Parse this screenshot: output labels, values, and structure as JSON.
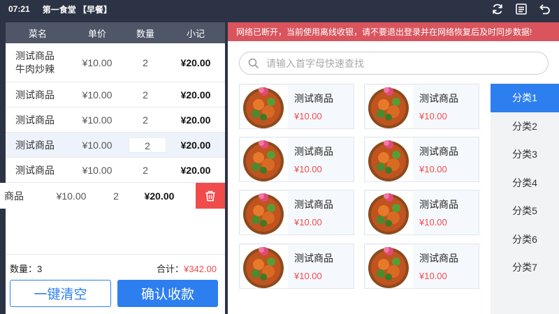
{
  "status_bar": {
    "time": "07:21",
    "store": "第一食堂 【早餐】"
  },
  "top_icons": [
    "sync-icon",
    "list-icon",
    "back-icon"
  ],
  "cart": {
    "headers": [
      "菜名",
      "单价",
      "数量",
      "小记"
    ],
    "rows": [
      {
        "name": "测试商品\n牛肉炒辣",
        "price": "¥10.00",
        "qty": "2",
        "subtotal": "¥20.00"
      },
      {
        "name": "测试商品",
        "price": "¥10.00",
        "qty": "2",
        "subtotal": "¥20.00"
      },
      {
        "name": "测试商品",
        "price": "¥10.00",
        "qty": "2",
        "subtotal": "¥20.00"
      },
      {
        "name": "测试商品",
        "price": "¥10.00",
        "qty": "2",
        "subtotal": "¥20.00"
      },
      {
        "name": "测试商品",
        "price": "¥10.00",
        "qty": "2",
        "subtotal": "¥20.00"
      }
    ],
    "swiped_row": {
      "name": "商品",
      "price": "¥10.00",
      "qty": "2",
      "subtotal": "¥20.00"
    },
    "qty_label": "数量：3",
    "total_label": "合计：",
    "total_amount": "¥342.00",
    "clear_label": "一键清空",
    "pay_label": "确认收款"
  },
  "warning": "网络已断开，当前使用离线收银，请不要退出登录并在网络恢复后及时同步数据!",
  "search": {
    "placeholder": "请输入首字母快速查找"
  },
  "products": [
    {
      "name": "测试商品",
      "price": "¥10.00"
    },
    {
      "name": "测试商品",
      "price": "¥10.00"
    },
    {
      "name": "测试商品",
      "price": "¥10.00"
    },
    {
      "name": "测试商品",
      "price": "¥10.00"
    },
    {
      "name": "测试商品",
      "price": "¥10.00"
    },
    {
      "name": "测试商品",
      "price": "¥10.00"
    },
    {
      "name": "测试商品",
      "price": "¥10.00"
    },
    {
      "name": "测试商品",
      "price": "¥10.00"
    }
  ],
  "categories": [
    "分类1",
    "分类2",
    "分类3",
    "分类4",
    "分类5",
    "分类6",
    "分类7"
  ],
  "colors": {
    "accent": "#2d7ff0",
    "danger": "#f04c4c",
    "warning_bg": "#d9545d",
    "header_bg": "#4f5667"
  }
}
